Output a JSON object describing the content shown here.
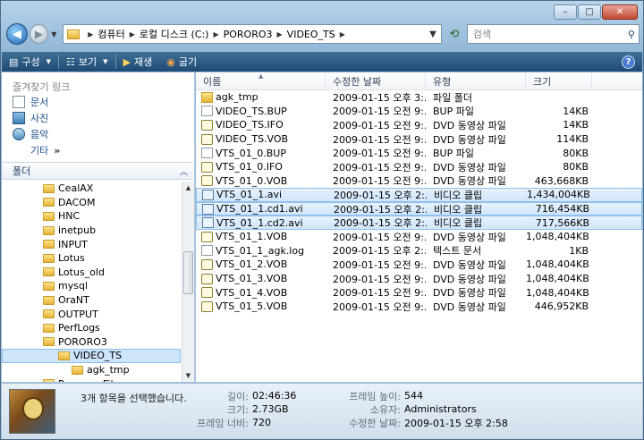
{
  "window": {
    "caption_min": "–",
    "caption_max": "□",
    "caption_close": "✕"
  },
  "address": {
    "crumbs": [
      "컴퓨터",
      "로컬 디스크 (C:)",
      "PORORO3",
      "VIDEO_TS"
    ],
    "search_placeholder": "검색"
  },
  "toolbar": {
    "organize": "구성",
    "views": "보기",
    "play": "재생",
    "burn": "굽기"
  },
  "favorites": {
    "heading": "즐겨찾기 링크",
    "items": [
      "문서",
      "사진",
      "음악"
    ],
    "more": "기타",
    "more_chevron": "»"
  },
  "folders": {
    "heading": "폴더",
    "tree": [
      {
        "label": "CealAX",
        "indent": 1
      },
      {
        "label": "DACOM",
        "indent": 1
      },
      {
        "label": "HNC",
        "indent": 1
      },
      {
        "label": "inetpub",
        "indent": 1
      },
      {
        "label": "INPUT",
        "indent": 1
      },
      {
        "label": "Lotus",
        "indent": 1
      },
      {
        "label": "Lotus_old",
        "indent": 1
      },
      {
        "label": "mysql",
        "indent": 1
      },
      {
        "label": "OraNT",
        "indent": 1
      },
      {
        "label": "OUTPUT",
        "indent": 1
      },
      {
        "label": "PerfLogs",
        "indent": 1
      },
      {
        "label": "PORORO3",
        "indent": 1
      },
      {
        "label": "VIDEO_TS",
        "indent": 2,
        "selected": true
      },
      {
        "label": "agk_tmp",
        "indent": 3
      },
      {
        "label": "Program Files",
        "indent": 1
      }
    ]
  },
  "columns": {
    "name": "이름",
    "date": "수정한 날짜",
    "type": "유형",
    "size": "크기"
  },
  "files": [
    {
      "name": "agk_tmp",
      "date": "2009-01-15 오후 3:...",
      "type": "파일 폴더",
      "size": "",
      "icon": "folder-icon"
    },
    {
      "name": "VIDEO_TS.BUP",
      "date": "2009-01-15 오전 9:...",
      "type": "BUP 파일",
      "size": "14KB",
      "icon": "file-icon"
    },
    {
      "name": "VIDEO_TS.IFO",
      "date": "2009-01-15 오전 9:...",
      "type": "DVD 동영상 파일",
      "size": "14KB",
      "icon": "dvd-icon"
    },
    {
      "name": "VIDEO_TS.VOB",
      "date": "2009-01-15 오전 9:...",
      "type": "DVD 동영상 파일",
      "size": "114KB",
      "icon": "dvd-icon"
    },
    {
      "name": "VTS_01_0.BUP",
      "date": "2009-01-15 오전 9:...",
      "type": "BUP 파일",
      "size": "80KB",
      "icon": "file-icon"
    },
    {
      "name": "VTS_01_0.IFO",
      "date": "2009-01-15 오전 9:...",
      "type": "DVD 동영상 파일",
      "size": "80KB",
      "icon": "dvd-icon"
    },
    {
      "name": "VTS_01_0.VOB",
      "date": "2009-01-15 오전 9:...",
      "type": "DVD 동영상 파일",
      "size": "463,668KB",
      "icon": "dvd-icon"
    },
    {
      "name": "VTS_01_1.avi",
      "date": "2009-01-15 오후 2:...",
      "type": "비디오 클립",
      "size": "1,434,004KB",
      "icon": "video-icon",
      "selected": true
    },
    {
      "name": "VTS_01_1.cd1.avi",
      "date": "2009-01-15 오후 2:...",
      "type": "비디오 클립",
      "size": "716,454KB",
      "icon": "video-icon",
      "selected": true
    },
    {
      "name": "VTS_01_1.cd2.avi",
      "date": "2009-01-15 오후 2:...",
      "type": "비디오 클립",
      "size": "717,566KB",
      "icon": "video-icon",
      "selected": true
    },
    {
      "name": "VTS_01_1.VOB",
      "date": "2009-01-15 오전 9:...",
      "type": "DVD 동영상 파일",
      "size": "1,048,404KB",
      "icon": "dvd-icon"
    },
    {
      "name": "VTS_01_1_agk.log",
      "date": "2009-01-15 오후 2:...",
      "type": "텍스트 문서",
      "size": "1KB",
      "icon": "file-icon"
    },
    {
      "name": "VTS_01_2.VOB",
      "date": "2009-01-15 오전 9:...",
      "type": "DVD 동영상 파일",
      "size": "1,048,404KB",
      "icon": "dvd-icon"
    },
    {
      "name": "VTS_01_3.VOB",
      "date": "2009-01-15 오전 9:...",
      "type": "DVD 동영상 파일",
      "size": "1,048,404KB",
      "icon": "dvd-icon"
    },
    {
      "name": "VTS_01_4.VOB",
      "date": "2009-01-15 오전 9:...",
      "type": "DVD 동영상 파일",
      "size": "1,048,404KB",
      "icon": "dvd-icon"
    },
    {
      "name": "VTS_01_5.VOB",
      "date": "2009-01-15 오전 9:...",
      "type": "DVD 동영상 파일",
      "size": "446,952KB",
      "icon": "dvd-icon"
    }
  ],
  "details": {
    "title": "3개 항목을 선택했습니다.",
    "length_label": "길이:",
    "length_value": "02:46:36",
    "size_label": "크기:",
    "size_value": "2.73GB",
    "frame_width_label": "프레임 너비:",
    "frame_width_value": "720",
    "frame_height_label": "프레임 높이:",
    "frame_height_value": "544",
    "owner_label": "소유자:",
    "owner_value": "Administrators",
    "modified_label": "수정한 날짜:",
    "modified_value": "2009-01-15 오후 2:58"
  }
}
